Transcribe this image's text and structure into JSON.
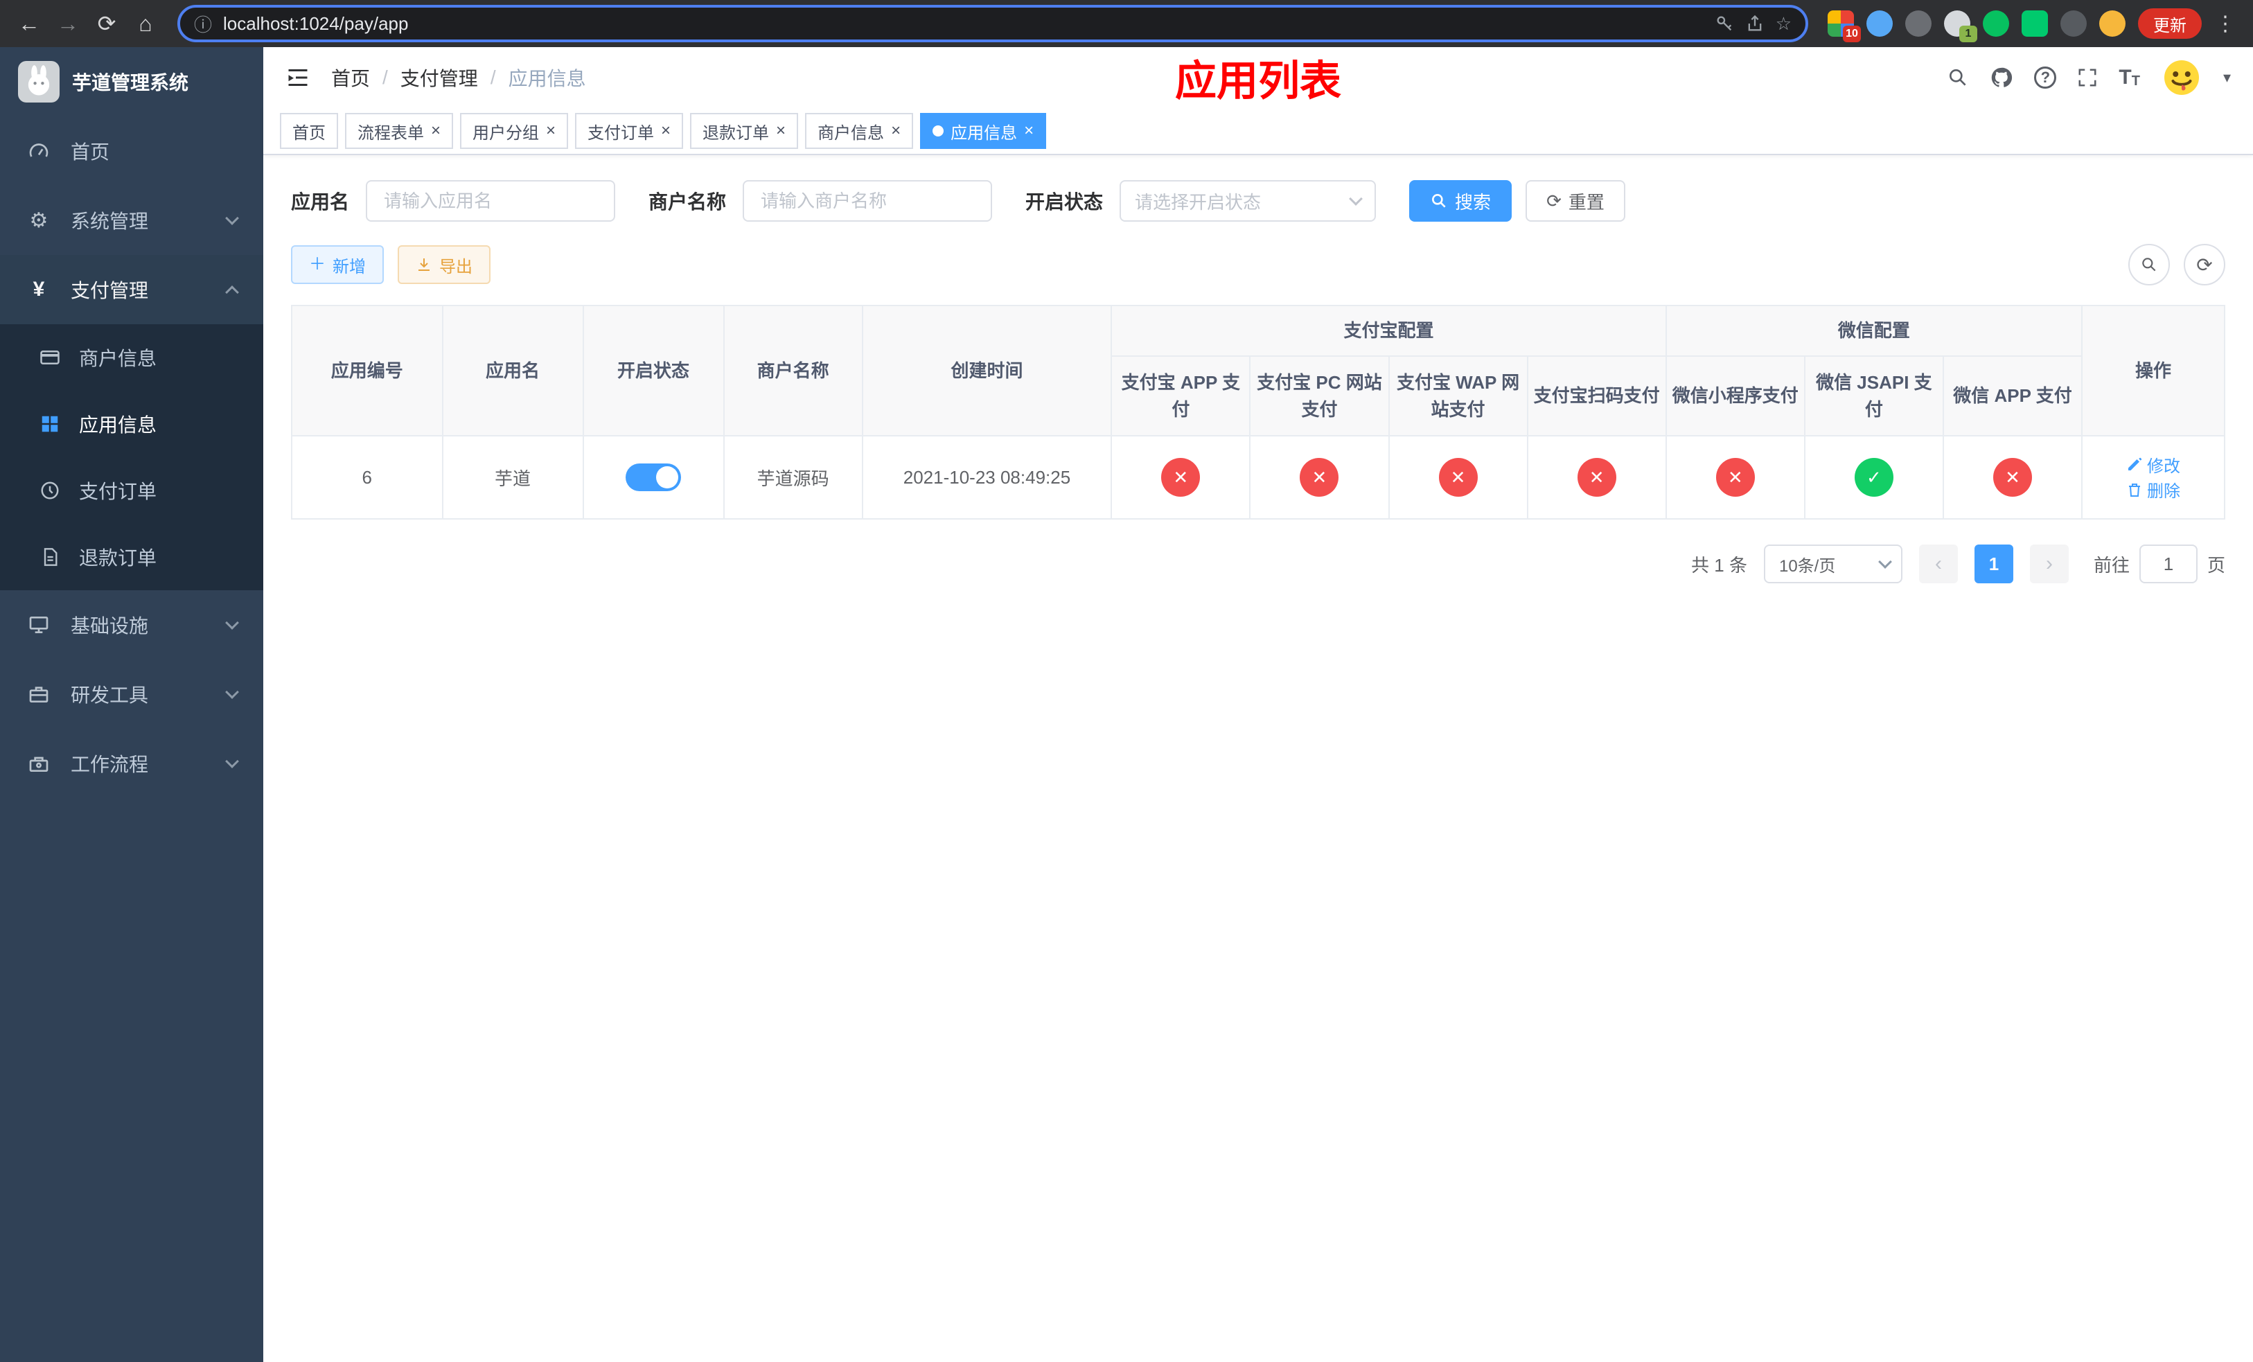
{
  "colors": {
    "primary": "#409eff",
    "danger": "#f34d4d",
    "success": "#13ce66",
    "sidebar_bg": "#304156",
    "submenu_bg": "#1f2d3d",
    "annotation_red": "#ff0000"
  },
  "icons": {
    "back": "←",
    "forward": "→",
    "reload": "⟳",
    "home": "⌂",
    "info": "ⓘ",
    "star": "☆",
    "kebab": "⋮",
    "caret": "▾",
    "gear": "⚙",
    "yen": "¥",
    "plus": "＋",
    "close": "✕",
    "check": "✓",
    "tab_close": "×",
    "question": "?",
    "text_size_big": "T",
    "text_size_small": "T",
    "refresh": "⟳",
    "prev": "‹",
    "next": "›"
  },
  "browser": {
    "url": "localhost:1024/pay/app",
    "update_label": "更新",
    "extension_badges": {
      "first": "10",
      "second": "1"
    }
  },
  "sidebar": {
    "app_title": "芋道管理系统",
    "items": {
      "home": "首页",
      "system": "系统管理",
      "payment": "支付管理",
      "infra": "基础设施",
      "devtools": "研发工具",
      "workflow": "工作流程"
    },
    "payment_children": {
      "merchant": "商户信息",
      "app": "应用信息",
      "order": "支付订单",
      "refund": "退款订单"
    }
  },
  "header": {
    "breadcrumb": [
      "首页",
      "支付管理",
      "应用信息"
    ],
    "annotation": "应用列表"
  },
  "tabs": [
    {
      "label": "首页",
      "closable": false,
      "active": false
    },
    {
      "label": "流程表单",
      "closable": true,
      "active": false
    },
    {
      "label": "用户分组",
      "closable": true,
      "active": false
    },
    {
      "label": "支付订单",
      "closable": true,
      "active": false
    },
    {
      "label": "退款订单",
      "closable": true,
      "active": false
    },
    {
      "label": "商户信息",
      "closable": true,
      "active": false
    },
    {
      "label": "应用信息",
      "closable": true,
      "active": true
    }
  ],
  "filters": {
    "app_name_label": "应用名",
    "app_name_placeholder": "请输入应用名",
    "merchant_label": "商户名称",
    "merchant_placeholder": "请输入商户名称",
    "status_label": "开启状态",
    "status_placeholder": "请选择开启状态",
    "search_label": "搜索",
    "reset_label": "重置"
  },
  "toolbar": {
    "add_label": "新增",
    "export_label": "导出"
  },
  "table": {
    "headers": {
      "app_id": "应用编号",
      "app_name": "应用名",
      "status": "开启状态",
      "merchant": "商户名称",
      "created": "创建时间",
      "alipay_group": "支付宝配置",
      "wechat_group": "微信配置",
      "alipay_app": "支付宝 APP 支付",
      "alipay_pc": "支付宝 PC 网站支付",
      "alipay_wap": "支付宝 WAP 网站支付",
      "alipay_qr": "支付宝扫码支付",
      "wx_mini": "微信小程序支付",
      "wx_jsapi": "微信 JSAPI 支付",
      "wx_app": "微信 APP 支付",
      "actions": "操作"
    },
    "row": {
      "app_id": "6",
      "app_name": "芋道",
      "enabled": true,
      "merchant": "芋道源码",
      "created": "2021-10-23 08:49:25",
      "configs": {
        "alipay_app": false,
        "alipay_pc": false,
        "alipay_wap": false,
        "alipay_qr": false,
        "wx_mini": false,
        "wx_jsapi": true,
        "wx_app": false
      }
    },
    "row_actions": {
      "edit": "修改",
      "delete": "删除"
    }
  },
  "pagination": {
    "total": "共 1 条",
    "page_size": "10条/页",
    "current_page": "1",
    "goto_label": "前往",
    "goto_value": "1",
    "page_unit_label": "页"
  }
}
